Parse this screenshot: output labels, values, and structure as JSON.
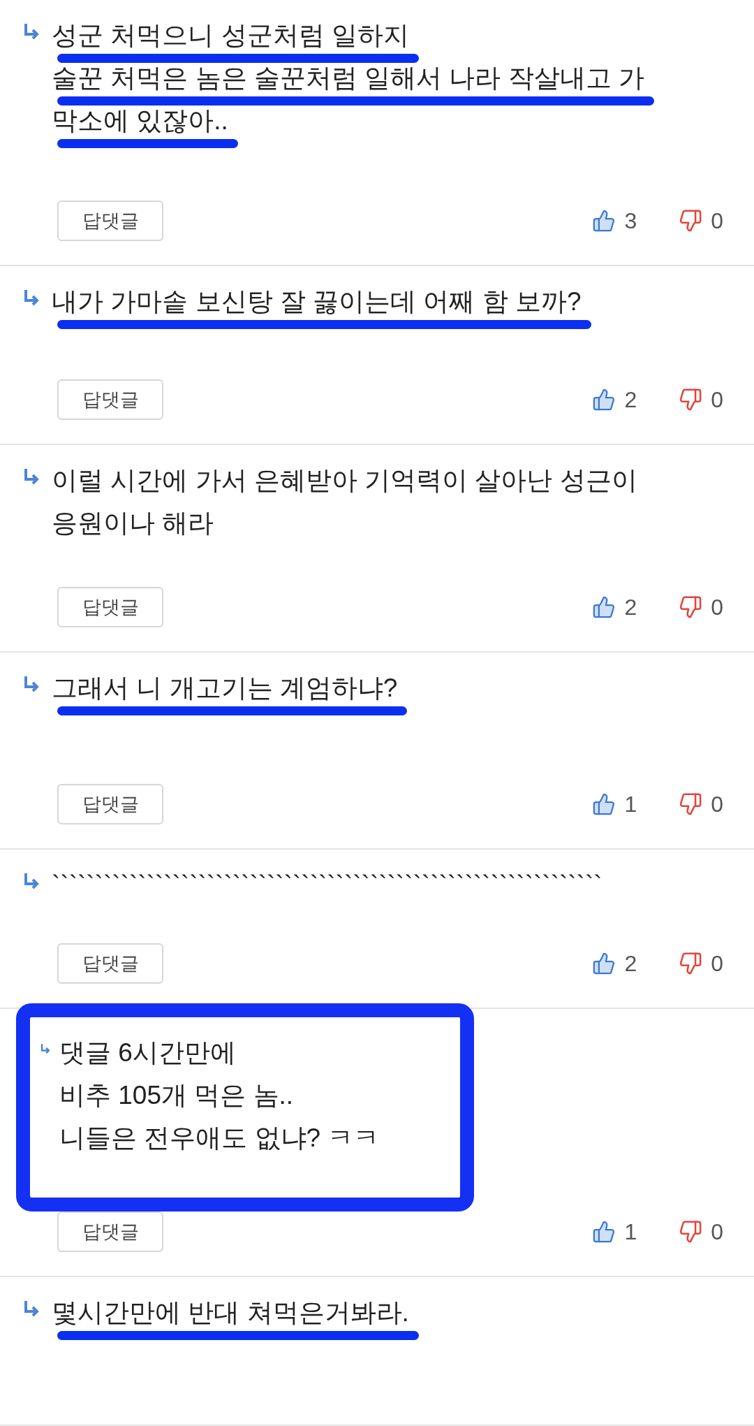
{
  "comments": [
    {
      "lines": [
        {
          "text": "성군 처먹으니 성군처럼 일하지",
          "underlined": true
        },
        {
          "text": "술꾼 처먹은 놈은 술꾼처럼 일해서 나라 작살내고 가",
          "underlined": true
        },
        {
          "text": "막소에 있잖아..",
          "underlined": true
        }
      ],
      "boxed": false,
      "reply": "답댓글",
      "likes": "3",
      "dislikes": "0"
    },
    {
      "lines": [
        {
          "text": "내가 가마솥 보신탕 잘 끓이는데 어째 함 보까?",
          "underlined": true
        }
      ],
      "boxed": false,
      "reply": "답댓글",
      "likes": "2",
      "dislikes": "0"
    },
    {
      "lines": [
        {
          "text": "이럴 시간에 가서 은혜받아 기억력이 살아난 성근이",
          "underlined": false
        },
        {
          "text": "응원이나 해라",
          "underlined": false
        }
      ],
      "boxed": false,
      "reply": "답댓글",
      "likes": "2",
      "dislikes": "0"
    },
    {
      "lines": [
        {
          "text": "그래서 니 개고기는 계엄하냐?",
          "underlined": true
        }
      ],
      "boxed": false,
      "reply": "답댓글",
      "likes": "1",
      "dislikes": "0"
    },
    {
      "lines": [
        {
          "text": "````````````````````````````````````````````````````````````````",
          "underlined": false
        }
      ],
      "boxed": false,
      "reply": "답댓글",
      "likes": "2",
      "dislikes": "0"
    },
    {
      "lines": [
        {
          "text": "댓글 6시간만에",
          "underlined": false
        },
        {
          "text": "비추 105개 먹은 놈..",
          "underlined": false
        },
        {
          "text": "니들은 전우애도 없냐? ㅋㅋ",
          "underlined": false
        }
      ],
      "boxed": true,
      "reply": "답댓글",
      "likes": "1",
      "dislikes": "0"
    },
    {
      "lines": [
        {
          "text": "몇시간만에 반대 쳐먹은거봐라.",
          "underlined": true
        }
      ],
      "boxed": false
    }
  ]
}
